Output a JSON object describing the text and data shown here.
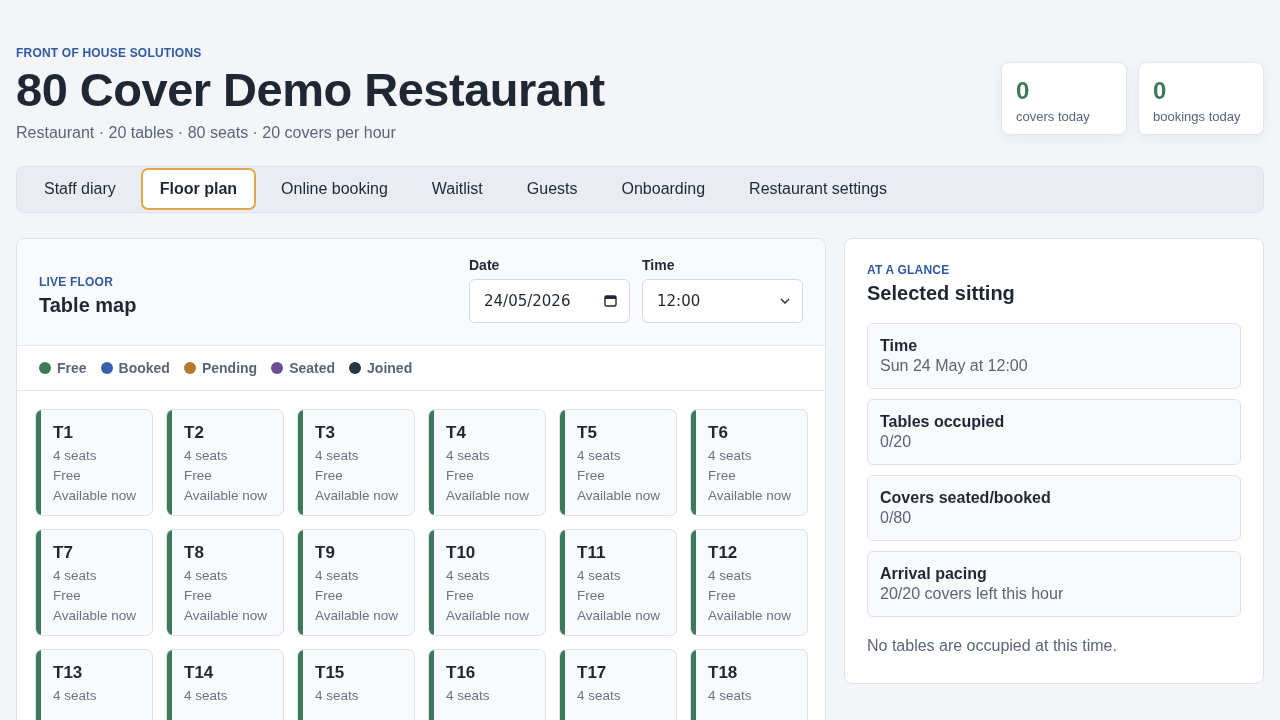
{
  "header": {
    "eyebrow": "FRONT OF HOUSE SOLUTIONS",
    "title": "80 Cover Demo Restaurant",
    "subtitle": "Restaurant · 20 tables · 80 seats · 20 covers per hour"
  },
  "stats": [
    {
      "value": "0",
      "label": "covers today"
    },
    {
      "value": "0",
      "label": "bookings today"
    }
  ],
  "tabs": [
    {
      "label": "Staff diary",
      "selected": false
    },
    {
      "label": "Floor plan",
      "selected": true
    },
    {
      "label": "Online booking",
      "selected": false
    },
    {
      "label": "Waitlist",
      "selected": false
    },
    {
      "label": "Guests",
      "selected": false
    },
    {
      "label": "Onboarding",
      "selected": false
    },
    {
      "label": "Restaurant settings",
      "selected": false
    }
  ],
  "floor": {
    "eyebrow": "LIVE FLOOR",
    "title": "Table map",
    "date": {
      "label": "Date",
      "value": "24/05/2026"
    },
    "time": {
      "label": "Time",
      "value": "12:00"
    },
    "legend": [
      {
        "label": "Free",
        "color": "#3d7a5a"
      },
      {
        "label": "Booked",
        "color": "#3b5fae"
      },
      {
        "label": "Pending",
        "color": "#b7782b"
      },
      {
        "label": "Seated",
        "color": "#6a4f94"
      },
      {
        "label": "Joined",
        "color": "#2a3447"
      }
    ],
    "tables": [
      {
        "name": "T1",
        "seats": "4 seats",
        "status": "Free",
        "note": "Available now",
        "color": "#3d7a5a"
      },
      {
        "name": "T2",
        "seats": "4 seats",
        "status": "Free",
        "note": "Available now",
        "color": "#3d7a5a"
      },
      {
        "name": "T3",
        "seats": "4 seats",
        "status": "Free",
        "note": "Available now",
        "color": "#3d7a5a"
      },
      {
        "name": "T4",
        "seats": "4 seats",
        "status": "Free",
        "note": "Available now",
        "color": "#3d7a5a"
      },
      {
        "name": "T5",
        "seats": "4 seats",
        "status": "Free",
        "note": "Available now",
        "color": "#3d7a5a"
      },
      {
        "name": "T6",
        "seats": "4 seats",
        "status": "Free",
        "note": "Available now",
        "color": "#3d7a5a"
      },
      {
        "name": "T7",
        "seats": "4 seats",
        "status": "Free",
        "note": "Available now",
        "color": "#3d7a5a"
      },
      {
        "name": "T8",
        "seats": "4 seats",
        "status": "Free",
        "note": "Available now",
        "color": "#3d7a5a"
      },
      {
        "name": "T9",
        "seats": "4 seats",
        "status": "Free",
        "note": "Available now",
        "color": "#3d7a5a"
      },
      {
        "name": "T10",
        "seats": "4 seats",
        "status": "Free",
        "note": "Available now",
        "color": "#3d7a5a"
      },
      {
        "name": "T11",
        "seats": "4 seats",
        "status": "Free",
        "note": "Available now",
        "color": "#3d7a5a"
      },
      {
        "name": "T12",
        "seats": "4 seats",
        "status": "Free",
        "note": "Available now",
        "color": "#3d7a5a"
      },
      {
        "name": "T13",
        "seats": "4 seats",
        "color": "#3d7a5a"
      },
      {
        "name": "T14",
        "seats": "4 seats",
        "color": "#3d7a5a"
      },
      {
        "name": "T15",
        "seats": "4 seats",
        "color": "#3d7a5a"
      },
      {
        "name": "T16",
        "seats": "4 seats",
        "color": "#3d7a5a"
      },
      {
        "name": "T17",
        "seats": "4 seats",
        "color": "#3d7a5a"
      },
      {
        "name": "T18",
        "seats": "4 seats",
        "color": "#3d7a5a"
      }
    ]
  },
  "glance": {
    "eyebrow": "AT A GLANCE",
    "title": "Selected sitting",
    "items": [
      {
        "label": "Time",
        "value": "Sun 24 May at 12:00"
      },
      {
        "label": "Tables occupied",
        "value": "0/20"
      },
      {
        "label": "Covers seated/booked",
        "value": "0/80"
      },
      {
        "label": "Arrival pacing",
        "value": "20/20 covers left this hour"
      }
    ],
    "note": "No tables are occupied at this time."
  }
}
